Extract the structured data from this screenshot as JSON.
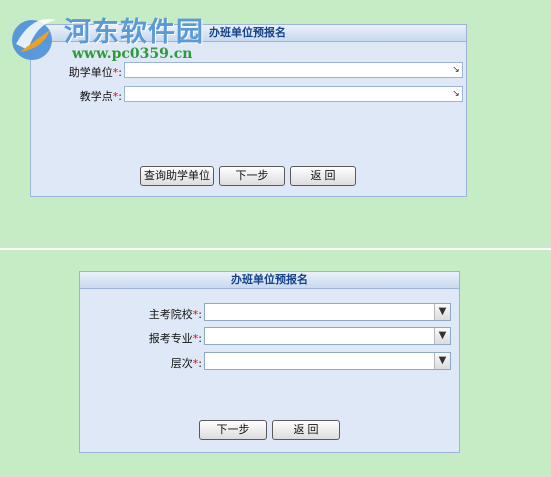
{
  "watermark": {
    "title": "河东软件园",
    "url": "www.pc0359.cn"
  },
  "form1": {
    "title": "办班单位预报名",
    "fields": [
      {
        "label": "助学单位",
        "required_mark": "*",
        "colon": ":"
      },
      {
        "label": "教学点",
        "required_mark": "*",
        "colon": ":"
      }
    ],
    "buttons": {
      "query": "查询助学单位",
      "next": "下一步",
      "back": "返 回"
    }
  },
  "form2": {
    "title": "办班单位预报名",
    "fields": [
      {
        "label": "主考院校",
        "required_mark": "*",
        "colon": ":"
      },
      {
        "label": "报考专业",
        "required_mark": "*",
        "colon": ":"
      },
      {
        "label": "层次",
        "required_mark": "*",
        "colon": ":"
      }
    ],
    "buttons": {
      "next": "下一步",
      "back": "返 回"
    }
  },
  "colors": {
    "background": "#c6ecc6",
    "panel": "#dfe8f6",
    "header_text": "#15428b",
    "required": "#ee0000"
  },
  "icons": {
    "combo_arrow": "chevron-down-icon",
    "logo": "watermark-logo-icon"
  }
}
